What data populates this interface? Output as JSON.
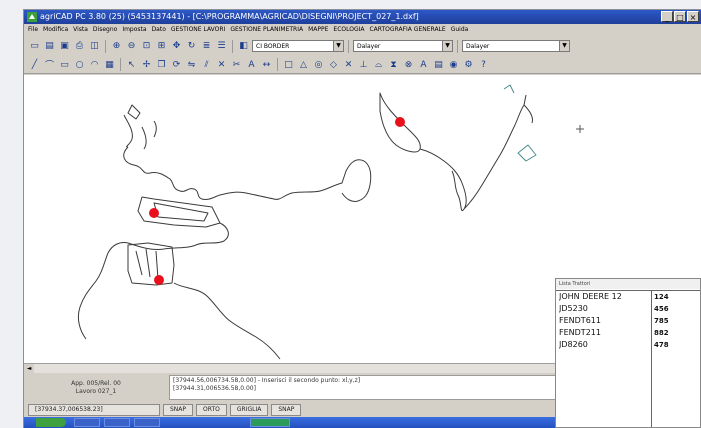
{
  "window": {
    "title": "agriCAD PC 3.80 (25) (5453137441) - [C:\\PROGRAMMA\\AGRICAD\\DISEGNI\\PROJECT_027_1.dxf]"
  },
  "menu": [
    "File",
    "Modifica",
    "Vista",
    "Disegno",
    "Imposta",
    "Dato",
    "GESTIONE LAVORI",
    "GESTIONE PLANIMETRIA",
    "MAPPE",
    "ECOLOGIA",
    "CARTOGRAFIA GENERALE",
    "Guida"
  ],
  "toolbar": {
    "layer_select": "CI BORDER",
    "linetype_select": "Dalayer",
    "lineweight_select": "Dalayer"
  },
  "command": {
    "info_line1": "App. 005/Rel. 00",
    "info_line2": "Lavoro 027_1",
    "line1": "[37944.56,006734.58,0.00] - Inserisci il secondo punto: xl,y,z]",
    "line2": "[37944.31,006536.58,0.00]"
  },
  "status": {
    "coords": "[37934.37,006538.23]",
    "buttons": [
      "SNAP",
      "ORTO",
      "GRIGLIA",
      "SNAP"
    ]
  },
  "popup": {
    "title": "Lista Trattori",
    "names": [
      "JOHN DEERE 12",
      "JD5230",
      "FENDT611",
      "FENDT211",
      "JD8260"
    ],
    "values": [
      "124",
      "456",
      "785",
      "882",
      "478"
    ]
  },
  "colors": {
    "marker": "#e8101a",
    "track": "#3a3a3a",
    "titlebar": "#2d58c8"
  }
}
